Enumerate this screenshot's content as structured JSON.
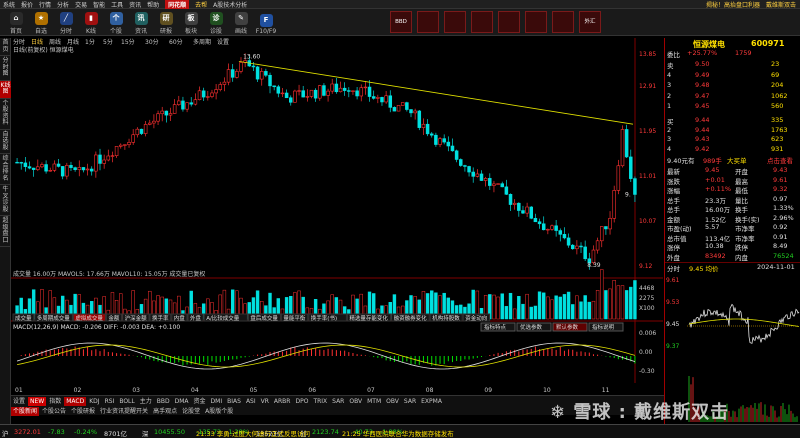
{
  "menu": {
    "items": [
      "系统",
      "报价",
      "行情",
      "分析",
      "交易",
      "智能",
      "工具",
      "资讯",
      "帮助",
      "",
      "",
      "",
      "",
      "A股技术分析"
    ],
    "brand": "同花顺",
    "mode": "去帮",
    "right": [
      "热点",
      "揭秘！高抬盘口利器",
      "戴维斯双击"
    ]
  },
  "toolbar": {
    "items": [
      {
        "label": "首页",
        "icon": "⌂",
        "color": "#2a2a2a"
      },
      {
        "label": "自选",
        "icon": "★",
        "color": "#b07000"
      },
      {
        "label": "分时",
        "icon": "╱",
        "color": "#204080"
      },
      {
        "label": "K线",
        "icon": "▮",
        "color": "#a01010"
      },
      {
        "label": "个股",
        "icon": "个",
        "color": "#3060a0"
      },
      {
        "label": "资讯",
        "icon": "讯",
        "color": "#206060"
      },
      {
        "label": "研报",
        "icon": "研",
        "color": "#605020"
      },
      {
        "label": "板块",
        "icon": "板",
        "color": "#404040"
      },
      {
        "label": "诊股",
        "icon": "诊",
        "color": "#205020"
      },
      {
        "label": "画线",
        "icon": "✎",
        "color": "#404040"
      },
      {
        "label": "F10/F9",
        "icon": "F",
        "color": "#2050a0"
      },
      {
        "label": "",
        "icon": "",
        "color": "#1a1a1a"
      },
      {
        "label": "",
        "icon": "",
        "color": "#1a1a1a"
      },
      {
        "label": "",
        "icon": "",
        "color": "#1a1a1a"
      },
      {
        "label": "",
        "icon": "",
        "color": "#1a1a1a"
      },
      {
        "label": "",
        "icon": "",
        "color": "#1a1a1a"
      },
      {
        "label": "",
        "icon": "",
        "color": "#1a1a1a"
      }
    ],
    "right": [
      "BBD",
      "",
      "",
      "",
      "",
      "",
      "",
      "外汇"
    ]
  },
  "sidetabs": [
    "首页",
    "分时图",
    "K线图",
    "个股资料",
    "自选股",
    "综合排名",
    "牛叉诊股",
    "超级盘口"
  ],
  "chart": {
    "periods": [
      "分时",
      "日线",
      "周线",
      "月线",
      "1分",
      "5分",
      "15分",
      "30分",
      "60分",
      "多周期",
      "设置"
    ],
    "header": "日线(前复权)  恒源煤电",
    "price_high_label": "13.60",
    "price_low_label": "8.39",
    "last_label": "9.",
    "price_axis": [
      "12.91",
      "11.95",
      "11.01",
      "10.07",
      "9.12"
    ],
    "volume_header": "成交量 16.00万 MAVOL5: 17.66万 MAVOL10: 15.05万 成交量已复权",
    "vol_axis": [
      "4468",
      "2275",
      "X100"
    ],
    "indicator_tabs": [
      "成交量",
      "多周期成交量",
      "虚拟成交量",
      "金额",
      "沪深金额",
      "换手率",
      "内盘",
      "外盘",
      "A/比较成交量",
      "盘后成交量",
      "量能平衡",
      "换手率(书)",
      "精选量存能变化",
      "融资融券变化",
      "机构持股数",
      "资金动向"
    ],
    "macd_header": "MACD(12,26,9) MACD: -0.206 DIFF: -0.003 DEA: +0.100",
    "macd_buttons": [
      "指标特点",
      "优选参数",
      "默认参数",
      "指标说明"
    ],
    "macd_axis": [
      "0.006",
      "0.00",
      "-0.30"
    ],
    "months": [
      "01",
      "02",
      "03",
      "04",
      "05",
      "06",
      "07",
      "08",
      "09",
      "10",
      "11"
    ]
  },
  "bottom": {
    "row1": [
      "设置",
      "NEW",
      "指数",
      "MACD",
      "KDJ",
      "RSI",
      "BOLL",
      "主力",
      "BBD",
      "DMA",
      "资金",
      "DMI",
      "BIAS",
      "ASI",
      "VR",
      "ARBR",
      "DPO",
      "TRIX",
      "SAR",
      "OBV",
      "MTM",
      "OBV",
      "SAR",
      "EXPMA"
    ],
    "row2": [
      "个股新闻",
      "个股公告",
      "个股研报",
      "行业资讯提醒开关",
      "高手观点",
      "论股堂",
      "A股版个股"
    ]
  },
  "info": {
    "name": "恒源煤电",
    "code": "600971",
    "webi_label": "委比",
    "webi": "+25.77%",
    "weicha": "1759",
    "asks": [
      {
        "l": "卖",
        "p": "9.50",
        "v": "23"
      },
      {
        "l": "4",
        "p": "9.49",
        "v": "69"
      },
      {
        "l": "3",
        "p": "9.48",
        "v": "204"
      },
      {
        "l": "2",
        "p": "9.47",
        "v": "1062"
      },
      {
        "l": "1",
        "p": "9.45",
        "v": "560"
      }
    ],
    "bids": [
      {
        "l": "买",
        "p": "9.44",
        "v": "335"
      },
      {
        "l": "2",
        "p": "9.44",
        "v": "1763"
      },
      {
        "l": "3",
        "p": "9.43",
        "v": "623"
      },
      {
        "l": "4",
        "p": "9.42",
        "v": "931"
      }
    ],
    "mid": {
      "a": "9.40元有",
      "b": "989手",
      "c": "大买单",
      "d": "点击查看"
    },
    "stats": [
      [
        "最新",
        "9.45",
        "开盘",
        "9.43"
      ],
      [
        "涨跌",
        "+0.01",
        "最高",
        "9.61"
      ],
      [
        "涨幅",
        "+0.11%",
        "最低",
        "9.32"
      ],
      [
        "总手",
        "23.3万",
        "量比",
        "0.97"
      ],
      [
        "总手",
        "16.00万",
        "换手",
        "1.33%"
      ],
      [
        "金额",
        "1.52亿",
        "换手(实)",
        "2.96%"
      ],
      [
        "市盈(动)",
        "5.57",
        "市净率",
        "0.92"
      ],
      [
        "总市值",
        "113.4亿",
        "市净率",
        "0.91"
      ],
      [
        "涨停",
        "10.38",
        "跌停",
        "8.49"
      ],
      [
        "外盘",
        "83492",
        "内盘",
        "76524"
      ]
    ],
    "intraday_header": [
      "分时",
      "9.45 均价",
      "2024-11-01"
    ],
    "intraday_axis": [
      "9.61",
      "9.53",
      "9.45",
      "9.37"
    ]
  },
  "ticker": [
    "沪",
    "3272.01",
    "-7.83",
    "-0.24%",
    "8701亿",
    "深",
    "10455.50",
    "-135.72",
    "-1.28%",
    "13523亿",
    "创",
    "2123.74",
    "-40.72",
    "-1.88%",
    "21:33 李勇:过度大何进行正式反思访问",
    "21:25 华西医院联合华为数据存储发布"
  ]
}
